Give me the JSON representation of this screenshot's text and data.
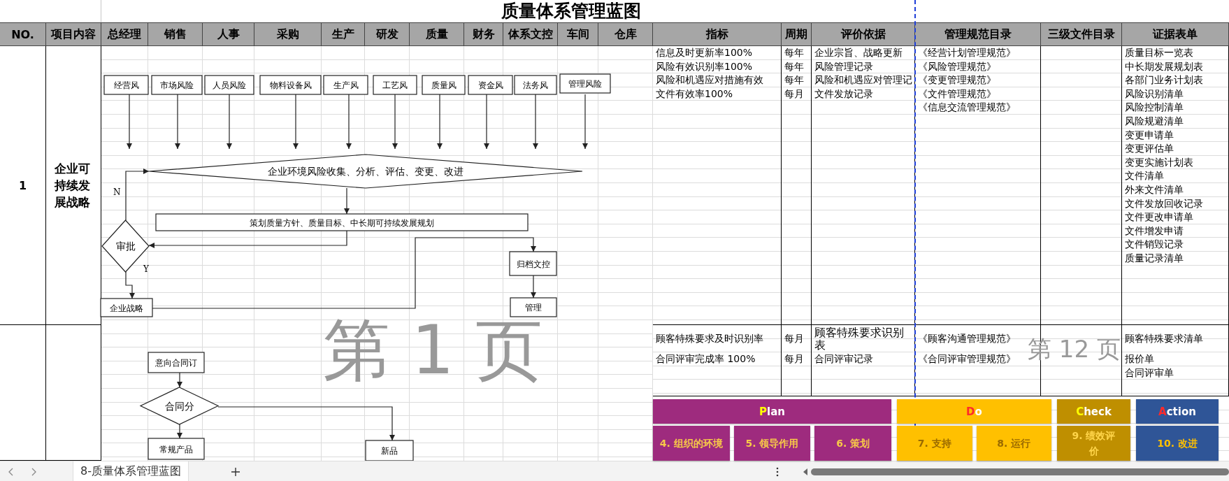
{
  "title": "质量体系管理蓝图",
  "columns": [
    "NO.",
    "项目内容",
    "总经理",
    "销售",
    "人事",
    "采购",
    "生产",
    "研发",
    "质量",
    "财务",
    "体系文控",
    "车间",
    "仓库",
    "指标",
    "周期",
    "评价依据",
    "管理规范目录",
    "三级文件目录",
    "证据表单"
  ],
  "rows": [
    {
      "no": "1",
      "item": "企业可持续发展战略",
      "indicators": [
        "信息及时更新率100%",
        "风险有效识别率100%",
        "风险和机遇应对措施有效",
        "文件有效率100%"
      ],
      "periods": [
        "每年",
        "每年",
        "每年",
        "每月"
      ],
      "evaluation_basis": [
        "企业宗旨、战略更新",
        "风险管理记录",
        "风险和机遇应对管理记",
        "文件发放记录"
      ],
      "management_specs": [
        "《经营计划管理规范》",
        "《风险管理规范》",
        "《变更管理规范》",
        "《文件管理规范》",
        "《信息交流管理规范》"
      ],
      "evidence_forms": [
        "质量目标一览表",
        "中长期发展规划表",
        "各部门业务计划表",
        "风险识别清单",
        "风险控制清单",
        "风险规避清单",
        "变更申请单",
        "变更评估单",
        "变更实施计划表",
        "文件清单",
        "外来文件清单",
        "文件发放回收记录",
        "文件更改申请单",
        "文件增发申请",
        "文件销毁记录",
        "质量记录清单"
      ]
    },
    {
      "indicators": [
        "顾客特殊要求及时识别率",
        "合同评审完成率 100%"
      ],
      "periods": [
        "每月",
        "每月"
      ],
      "evaluation_basis": [
        "顾客特殊要求识别表",
        "合同评审记录"
      ],
      "management_specs": [
        "《顾客沟通管理规范》",
        "《合同评审管理规范》"
      ],
      "evidence_forms": [
        "顾客特殊要求清单",
        "报价单",
        "合同评审单"
      ]
    }
  ],
  "flowchart": {
    "nodes": [
      {
        "kind": "box",
        "label": "经营风"
      },
      {
        "kind": "box",
        "label": "市场风险"
      },
      {
        "kind": "box",
        "label": "人员风险"
      },
      {
        "kind": "box",
        "label": "物料设备风"
      },
      {
        "kind": "box",
        "label": "生产风"
      },
      {
        "kind": "box",
        "label": "工艺风"
      },
      {
        "kind": "box",
        "label": "质量风"
      },
      {
        "kind": "box",
        "label": "资金风"
      },
      {
        "kind": "box",
        "label": "法务风"
      },
      {
        "kind": "box",
        "label": "管理风险"
      },
      {
        "kind": "decision",
        "label": "企业环境风险收集、分析、评估、变更、改进"
      },
      {
        "kind": "box",
        "label": "策划质量方针、质量目标、中长期可持续发展规划"
      },
      {
        "kind": "decision",
        "label": "审批"
      },
      {
        "kind": "box",
        "label": "企业战略"
      },
      {
        "kind": "box",
        "label": "归档文控"
      },
      {
        "kind": "box",
        "label": "管理"
      },
      {
        "kind": "box",
        "label": "意向合同订"
      },
      {
        "kind": "decision",
        "label": "合同分"
      },
      {
        "kind": "box",
        "label": "常规产品"
      },
      {
        "kind": "box",
        "label": "新品"
      }
    ],
    "edge_labels": [
      "N",
      "Y"
    ]
  },
  "page_labels": [
    "第 1 页",
    "第 12 页"
  ],
  "pdca": [
    {
      "heading": "Plan",
      "color": "#9e2b7e",
      "steps": [
        "4. 组织的环境",
        "5. 领导作用",
        "6. 策划"
      ]
    },
    {
      "heading": "Do",
      "color": "#ffc000",
      "steps": [
        "7. 支持",
        "8. 运行"
      ]
    },
    {
      "heading": "Check",
      "color": "#bf8f00",
      "steps": [
        "9. 绩效评价"
      ]
    },
    {
      "heading": "Action",
      "color": "#2f5597",
      "steps": [
        "10. 改进"
      ]
    }
  ],
  "sheet_tabs": [
    {
      "label": "8-质量体系管理蓝图",
      "selected": true
    }
  ]
}
